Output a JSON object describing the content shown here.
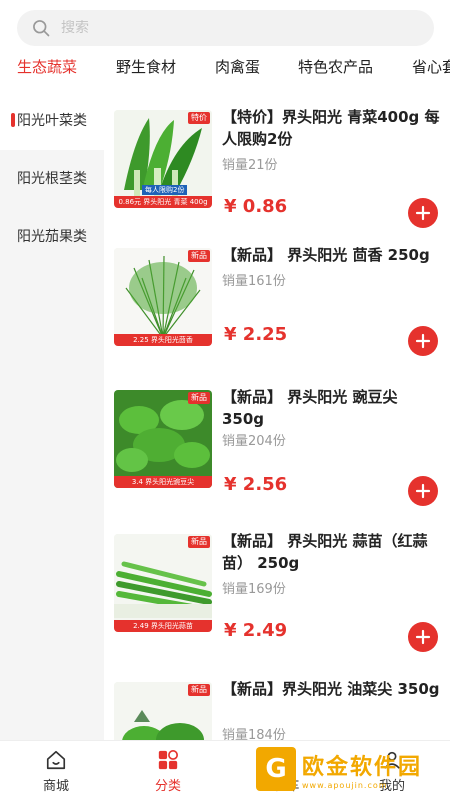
{
  "search": {
    "placeholder": "搜索"
  },
  "categories": [
    {
      "label": "生态蔬菜",
      "active": true
    },
    {
      "label": "野生食材",
      "active": false
    },
    {
      "label": "肉禽蛋",
      "active": false
    },
    {
      "label": "特色农产品",
      "active": false
    },
    {
      "label": "省心套",
      "active": false
    }
  ],
  "sidebar": {
    "items": [
      {
        "label": "阳光叶菜类",
        "active": true
      },
      {
        "label": "阳光根茎类",
        "active": false
      },
      {
        "label": "阳光茄果类",
        "active": false
      }
    ]
  },
  "products": [
    {
      "title": "【特价】界头阳光 青菜400g 每人限购2份",
      "sales": "销量21份",
      "price": "¥ 0.86",
      "badge": "特价",
      "limit": "每人限购2份",
      "strip": "0.86元 界头阳光 青菜 400g",
      "image": "green-vegetable-icon"
    },
    {
      "title": "【新品】 界头阳光 茴香 250g",
      "sales": "销量161份",
      "price": "¥ 2.25",
      "badge": "新品",
      "strip": "2.25 界头阳光茴香",
      "image": "fennel-icon"
    },
    {
      "title": "【新品】 界头阳光 豌豆尖 350g",
      "sales": "销量204份",
      "price": "¥ 2.56",
      "badge": "新品",
      "strip": "3.4 界头阳光豌豆尖",
      "image": "pea-shoot-icon"
    },
    {
      "title": "【新品】 界头阳光 蒜苗（红蒜苗） 250g",
      "sales": "销量169份",
      "price": "¥ 2.49",
      "badge": "新品",
      "strip": "2.49 界头阳光蒜苗",
      "image": "garlic-sprout-icon"
    },
    {
      "title": "【新品】界头阳光 油菜尖 350g",
      "sales": "销量184份",
      "price": "",
      "badge": "新品",
      "strip": "",
      "image": "rape-shoot-icon"
    }
  ],
  "tabbar": [
    {
      "label": "商城",
      "icon": "home-icon",
      "active": false
    },
    {
      "label": "分类",
      "icon": "category-icon",
      "active": true
    },
    {
      "label": "购物车",
      "icon": "cart-icon",
      "active": false
    },
    {
      "label": "我的",
      "icon": "user-icon",
      "active": false
    }
  ],
  "watermark": {
    "mark": "G",
    "title": "欧金软件园",
    "url": "www.apoujin.com"
  },
  "colors": {
    "accent": "#e5322d",
    "sidebar_bg": "#f5f5f5",
    "muted": "#999999"
  }
}
